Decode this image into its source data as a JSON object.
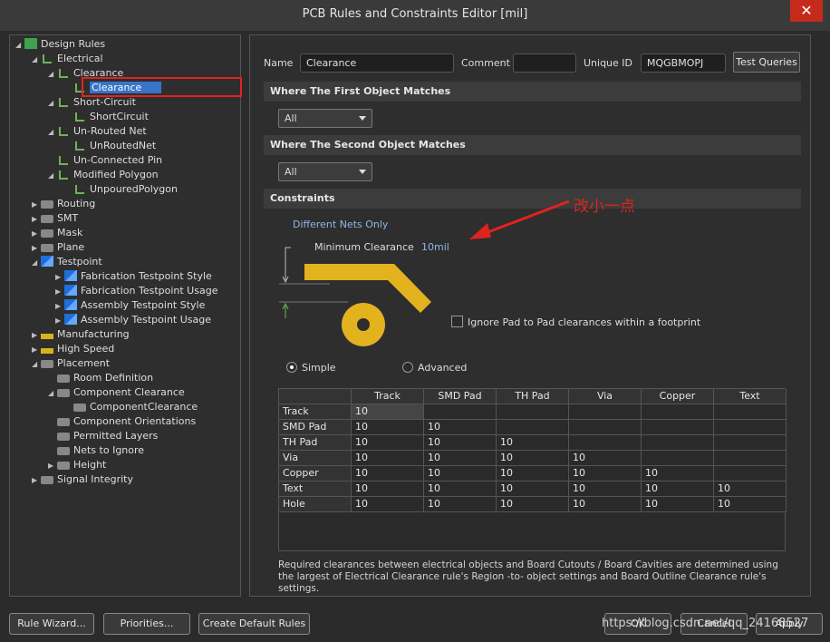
{
  "window": {
    "title": "PCB Rules and Constraints Editor [mil]",
    "close_icon": "close-icon"
  },
  "tree": {
    "items": [
      {
        "label": "Design Rules",
        "icon": "design-rules-icon"
      },
      {
        "label": "Electrical",
        "icon": "rule-folder-icon"
      },
      {
        "label": "Clearance",
        "icon": "rule-icon"
      },
      {
        "label": "Clearance",
        "icon": "rule-icon"
      },
      {
        "label": "Short-Circuit",
        "icon": "rule-icon"
      },
      {
        "label": "ShortCircuit",
        "icon": "rule-icon"
      },
      {
        "label": "Un-Routed Net",
        "icon": "rule-icon"
      },
      {
        "label": "UnRoutedNet",
        "icon": "rule-icon"
      },
      {
        "label": "Un-Connected Pin",
        "icon": "rule-icon"
      },
      {
        "label": "Modified Polygon",
        "icon": "rule-icon"
      },
      {
        "label": "UnpouredPolygon",
        "icon": "rule-icon"
      },
      {
        "label": "Routing",
        "icon": "routing-icon"
      },
      {
        "label": "SMT",
        "icon": "smt-icon"
      },
      {
        "label": "Mask",
        "icon": "mask-icon"
      },
      {
        "label": "Plane",
        "icon": "plane-icon"
      },
      {
        "label": "Testpoint",
        "icon": "testpoint-icon"
      },
      {
        "label": "Fabrication Testpoint Style",
        "icon": "testpoint-rule-icon"
      },
      {
        "label": "Fabrication Testpoint Usage",
        "icon": "testpoint-rule-icon"
      },
      {
        "label": "Assembly Testpoint Style",
        "icon": "testpoint-rule-icon"
      },
      {
        "label": "Assembly Testpoint Usage",
        "icon": "testpoint-rule-icon"
      },
      {
        "label": "Manufacturing",
        "icon": "manufacturing-icon"
      },
      {
        "label": "High Speed",
        "icon": "high-speed-icon"
      },
      {
        "label": "Placement",
        "icon": "placement-icon"
      },
      {
        "label": "Room Definition",
        "icon": "placement-rule-icon"
      },
      {
        "label": "Component Clearance",
        "icon": "placement-rule-icon"
      },
      {
        "label": "ComponentClearance",
        "icon": "placement-rule-icon"
      },
      {
        "label": "Component Orientations",
        "icon": "placement-rule-icon"
      },
      {
        "label": "Permitted Layers",
        "icon": "placement-rule-icon"
      },
      {
        "label": "Nets to Ignore",
        "icon": "placement-rule-icon"
      },
      {
        "label": "Height",
        "icon": "placement-rule-icon"
      },
      {
        "label": "Signal Integrity",
        "icon": "signal-integrity-icon"
      }
    ]
  },
  "rule": {
    "name_label": "Name",
    "name_value": "Clearance",
    "comment_label": "Comment",
    "comment_value": "",
    "unique_id_label": "Unique ID",
    "unique_id_value": "MQGBMOPJ",
    "test_queries": "Test Queries"
  },
  "first_match": {
    "header": "Where The First Object Matches",
    "value": "All"
  },
  "second_match": {
    "header": "Where The Second Object Matches",
    "value": "All"
  },
  "constraints": {
    "header": "Constraints",
    "nets_mode": "Different Nets Only",
    "min_clearance_label": "Minimum Clearance",
    "min_clearance_value": "10mil",
    "annotation": "改小一点",
    "ignore_pad_label": "Ignore Pad to Pad clearances within a footprint",
    "simple_label": "Simple",
    "advanced_label": "Advanced",
    "mode_selected": "Simple"
  },
  "grid": {
    "columns": [
      "Track",
      "SMD Pad",
      "TH Pad",
      "Via",
      "Copper",
      "Text"
    ],
    "rows": [
      {
        "name": "Track",
        "values": [
          "10"
        ]
      },
      {
        "name": "SMD Pad",
        "values": [
          "10",
          "10"
        ]
      },
      {
        "name": "TH Pad",
        "values": [
          "10",
          "10",
          "10"
        ]
      },
      {
        "name": "Via",
        "values": [
          "10",
          "10",
          "10",
          "10"
        ]
      },
      {
        "name": "Copper",
        "values": [
          "10",
          "10",
          "10",
          "10",
          "10"
        ]
      },
      {
        "name": "Text",
        "values": [
          "10",
          "10",
          "10",
          "10",
          "10",
          "10"
        ]
      },
      {
        "name": "Hole",
        "values": [
          "10",
          "10",
          "10",
          "10",
          "10",
          "10"
        ]
      }
    ]
  },
  "note": "Required clearances between electrical objects and Board Cutouts / Board Cavities are determined using the largest of Electrical Clearance rule's Region -to- object settings and Board Outline Clearance rule's settings.",
  "footer": {
    "rule_wizard": "Rule Wizard...",
    "priorities": "Priorities...",
    "create_default": "Create Default Rules",
    "ok": "OK",
    "cancel": "Cancel",
    "apply": "Apply"
  },
  "watermark": "https://blog.csdn.net/qq_24168527",
  "colors": {
    "accent": "#3874c8",
    "highlight_box": "#e0231f",
    "track": "#e3b21f"
  }
}
